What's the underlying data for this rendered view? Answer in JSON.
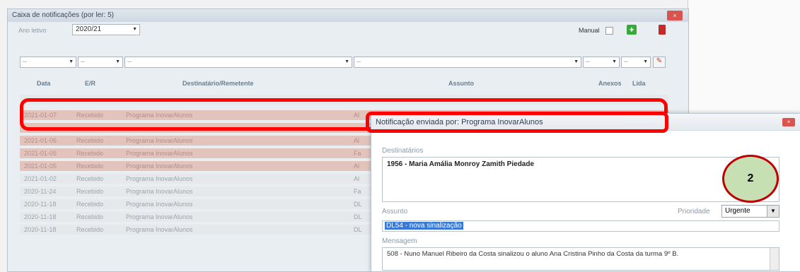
{
  "window": {
    "title": "Caixa de notificações (por ler: 5)",
    "close": "×"
  },
  "toolbar": {
    "year_label": "Ano letivo",
    "year_value": "2020/21",
    "manual_label": "Manual"
  },
  "filters": {
    "f1": "--",
    "f2": "--",
    "f3": "--",
    "f4": "--",
    "f5": "--",
    "f6": "--"
  },
  "table": {
    "headers": {
      "data": "Data",
      "er": "E/R",
      "dest": "Destinatário/Remetente",
      "assunto": "Assunto",
      "anexos": "Anexos",
      "lida": "Lida"
    },
    "rows": [
      {
        "date": "2021-01-07",
        "er": "Recebido",
        "dest": "Programa InovarAlunos",
        "assunto": "Al"
      },
      {
        "date": "2021-01-06",
        "er": "Recebido",
        "dest": "Programa InovarAlunos",
        "assunto": "Al"
      },
      {
        "date": "2021-01-05",
        "er": "Recebido",
        "dest": "Programa InovarAlunos",
        "assunto": "Fa"
      },
      {
        "date": "2021-01-05",
        "er": "Recebido",
        "dest": "Programa InovarAlunos",
        "assunto": "Al"
      },
      {
        "date": "2021-01-02",
        "er": "Recebido",
        "dest": "Programa InovarAlunos",
        "assunto": "Al"
      },
      {
        "date": "2020-11-24",
        "er": "Recebido",
        "dest": "Programa InovarAlunos",
        "assunto": "Fa"
      },
      {
        "date": "2020-11-18",
        "er": "Recebido",
        "dest": "Programa InovarAlunos",
        "assunto": "DL"
      },
      {
        "date": "2020-11-18",
        "er": "Recebido",
        "dest": "Programa InovarAlunos",
        "assunto": "DL"
      },
      {
        "date": "2020-11-18",
        "er": "Recebido",
        "dest": "Programa InovarAlunos",
        "assunto": "DL"
      }
    ]
  },
  "dialog": {
    "title": "Notificação enviada por: Programa InovarAlunos",
    "close": "×",
    "recipients_label": "Destinatários",
    "recipient": "1956 - Maria Amália Monroy Zamith Piedade",
    "subject_label": "Assunto",
    "subject_value": "DL54 - nova sinalização",
    "priority_label": "Prioridade",
    "priority_value": "Urgente",
    "message_label": "Mensagem",
    "message": "508 - Nuno Manuel Ribeiro da Costa sinalizou o aluno Ana Cristina Pinho da Costa da turma 9º B."
  },
  "badge": "2",
  "colors": {
    "highlight_row": "#e3c4bd",
    "annotation": "#ff0000",
    "badge_fill": "#c6e0b4"
  }
}
